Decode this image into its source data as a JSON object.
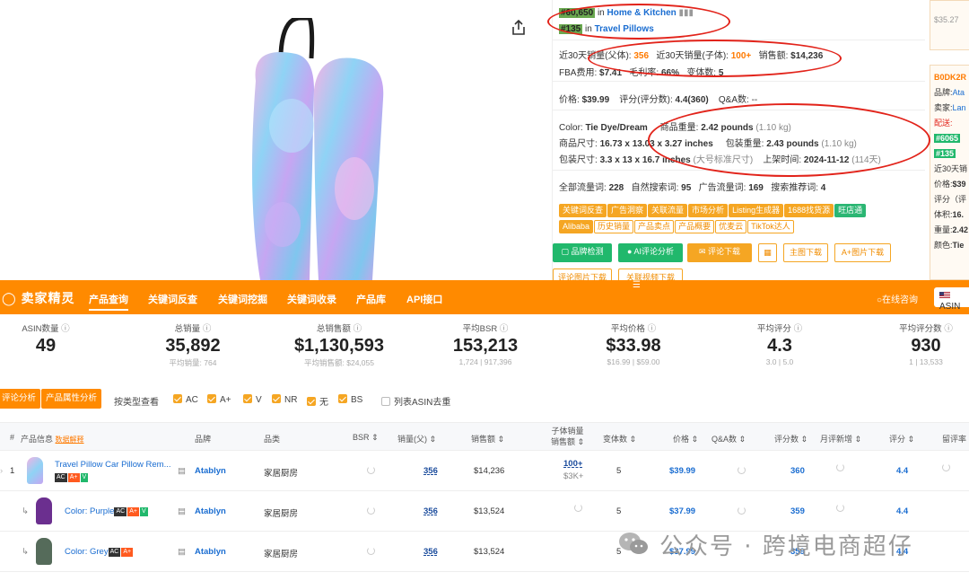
{
  "product_info": {
    "rank1_badge": "#60,650",
    "rank1_in": "in",
    "rank1_cat": "Home & Kitchen",
    "rank2_badge": "#135",
    "rank2_in": "in",
    "rank2_cat": "Travel Pillows",
    "sales_parent_label": "近30天销量(父体):",
    "sales_parent_value": "356",
    "sales_child_label": "近30天销量(子体):",
    "sales_child_value": "100+",
    "revenue_label": "销售额:",
    "revenue_value": "$14,236",
    "fba_label": "FBA费用:",
    "fba_value": "$7.41",
    "margin_label": "毛利率:",
    "margin_value": "66%",
    "variants_label": "变体数:",
    "variants_value": "5",
    "price_label": "价格:",
    "price_value": "$39.99",
    "rating_label": "评分(评分数):",
    "rating_value": "4.4(360)",
    "qa_label": "Q&A数:",
    "qa_value": "--",
    "color_label": "Color:",
    "color_value": "Tie Dye/Dream",
    "weight_label": "商品重量:",
    "weight_value": "2.42 pounds",
    "weight_kg": "(1.10 kg)",
    "size_label": "商品尺寸:",
    "size_value": "16.73 x 13.03 x 3.27 inches",
    "pkg_weight_label": "包装重量:",
    "pkg_weight_value": "2.43 pounds",
    "pkg_weight_kg": "(1.10 kg)",
    "pkg_size_label": "包装尺寸:",
    "pkg_size_value": "3.3 x 13 x 16.7 inches",
    "pkg_size_note": "(大号标准尺寸)",
    "launch_label": "上架时间:",
    "launch_value": "2024-11-12",
    "launch_days": "(114天)",
    "traffic_all_label": "全部流量词:",
    "traffic_all_value": "228",
    "traffic_natural_label": "自然搜索词:",
    "traffic_natural_value": "95",
    "traffic_ad_label": "广告流量词:",
    "traffic_ad_value": "169",
    "traffic_rec_label": "搜索推荐词:",
    "traffic_rec_value": "4"
  },
  "tags_row1": [
    "关键词反查",
    "广告洞察",
    "关联流量",
    "市场分析",
    "Listing生成器",
    "1688找货源",
    "旺店通"
  ],
  "tags_row2": [
    "Alibaba",
    "历史销量",
    "产品卖点",
    "产品概要",
    "优麦云",
    "TikTok达人"
  ],
  "action_buttons": {
    "brand_check": "品牌检测",
    "ai_review": "AI评论分析",
    "review_download": "评论下载",
    "calc_icon": "calculator-icon",
    "main_image_download": "主图下载",
    "aplus_download": "A+图片下载",
    "review_img_download": "评论图片下载",
    "related_video_download": "关联视频下载"
  },
  "side_panel": {
    "price_top": "$35.27",
    "asin": "B0DK2R",
    "brand_label": "品牌:",
    "brand_value": "Ata",
    "seller_label": "卖家:",
    "seller_value": "Lan",
    "ship_label": "配送:",
    "rank1": "#6065",
    "rank2": "#135",
    "sales_label": "近30天销",
    "price_label": "价格:",
    "price_value": "$39",
    "rating_label": "评分（评",
    "volume_label": "体积:",
    "volume_value": "16.",
    "weight_label": "重量:",
    "weight_value": "2.42",
    "color_label": "颜色:",
    "color_value": "Tie"
  },
  "nav": {
    "logo": "卖家精灵",
    "items": [
      "产品查询",
      "关键词反查",
      "关键词挖掘",
      "关键词收录",
      "产品库",
      "API接口"
    ],
    "online": "在线咨询",
    "country": "ASIN"
  },
  "stats": [
    {
      "label": "ASIN数量",
      "value": "49",
      "sub": ""
    },
    {
      "label": "总销量",
      "value": "35,892",
      "sub": "平均销量: 764"
    },
    {
      "label": "总销售额",
      "value": "$1,130,593",
      "sub": "平均销售额: $24,055"
    },
    {
      "label": "平均BSR",
      "value": "153,213",
      "sub": "1,724 | 917,396"
    },
    {
      "label": "平均价格",
      "value": "$33.98",
      "sub": "$16.99 | $59.00"
    },
    {
      "label": "平均评分",
      "value": "4.3",
      "sub": "3.0 | 5.0"
    },
    {
      "label": "平均评分数",
      "value": "930",
      "sub": "1 | 13,533"
    }
  ],
  "filters": {
    "btn1": "评论分析",
    "btn2": "产品属性分析",
    "type_label": "按类型查看",
    "checks": [
      "AC",
      "A+",
      "V",
      "NR",
      "无",
      "BS"
    ],
    "dedupe": "列表ASIN去重"
  },
  "table": {
    "headers": {
      "num": "#",
      "info": "产品信息",
      "info_link": "数据解释",
      "brand": "品牌",
      "category": "品类",
      "bsr": "BSR",
      "sales": "销量(父)",
      "revenue": "销售额",
      "child_sales": "子体销量",
      "child_revenue": "销售额",
      "variants": "变体数",
      "price": "价格",
      "qa": "Q&A数",
      "reviews": "评分数",
      "monthly_new": "月评新增",
      "rating": "评分",
      "retention": "留评率"
    },
    "rows": [
      {
        "index": "1",
        "title": "Travel Pillow Car Pillow Rem...",
        "badges": [
          "AC",
          "A+",
          "V"
        ],
        "brand": "Atablyn",
        "category": "家居厨房",
        "sales": "356",
        "revenue": "$14,236",
        "child_sales": "100+",
        "child_revenue": "$3K+",
        "variants": "5",
        "price": "$39.99",
        "reviews": "360",
        "rating": "4.4",
        "thumb_color": "#a9b9f0"
      },
      {
        "index": "",
        "title": "Color: Purple",
        "badges": [
          "AC",
          "A+",
          "V"
        ],
        "brand": "Atablyn",
        "category": "家居厨房",
        "sales": "356",
        "revenue": "$13,524",
        "child_sales": "",
        "child_revenue": "",
        "variants": "5",
        "price": "$37.99",
        "reviews": "359",
        "rating": "4.4",
        "thumb_color": "#6b2f8f"
      },
      {
        "index": "",
        "title": "Color: Grey",
        "badges": [
          "AC",
          "A+"
        ],
        "brand": "Atablyn",
        "category": "家居厨房",
        "sales": "356",
        "revenue": "$13,524",
        "child_sales": "",
        "child_revenue": "",
        "variants": "5",
        "price": "$37.99",
        "reviews": "359",
        "rating": "4.4",
        "thumb_color": "#556b5a"
      }
    ]
  },
  "watermark": "公众号 · 跨境电商超仔",
  "colors": {
    "accent": "#ff8a00",
    "green": "#21b86c",
    "link": "#1a6dd1",
    "annotation": "#e2231a"
  }
}
